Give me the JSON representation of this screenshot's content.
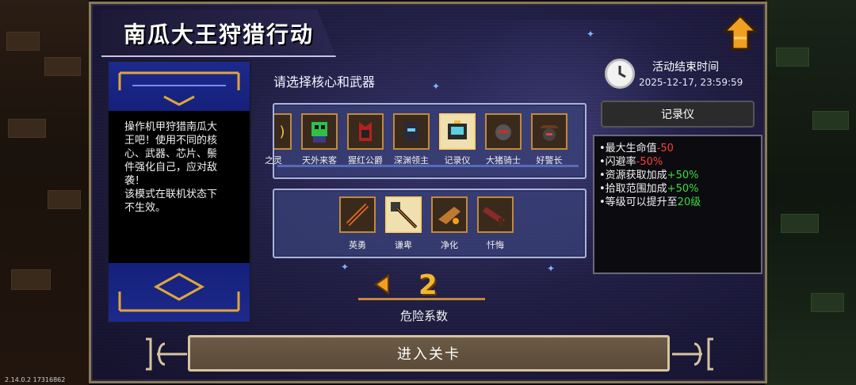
{
  "title": "南瓜大王狩猎行动",
  "description": [
    "操作机甲狩猎南瓜大",
    "王吧！使用不同的核",
    "心、武器、芯片、鬃",
    "件强化自己，应对敌",
    "袭！",
    "该模式在联机状态下",
    "不生效。"
  ],
  "core_weapon_prompt": "请选择核心和武器",
  "cores": [
    {
      "label": "之灵",
      "icon": "spirit-core-icon"
    },
    {
      "label": "天外来客",
      "icon": "alien-visitor-core-icon"
    },
    {
      "label": "猩红公爵",
      "icon": "scarlet-duke-core-icon"
    },
    {
      "label": "深渊领主",
      "icon": "abyss-lord-core-icon"
    },
    {
      "label": "记录仪",
      "icon": "recorder-core-icon",
      "selected": true
    },
    {
      "label": "大猪骑士",
      "icon": "pig-knight-core-icon"
    },
    {
      "label": "好警长",
      "icon": "sheriff-core-icon"
    }
  ],
  "weapons": [
    {
      "label": "英勇",
      "icon": "brave-weapon-icon"
    },
    {
      "label": "谦卑",
      "icon": "humble-weapon-icon",
      "selected": true
    },
    {
      "label": "净化",
      "icon": "purify-weapon-icon"
    },
    {
      "label": "忏悔",
      "icon": "repent-weapon-icon"
    }
  ],
  "difficulty": {
    "value": "2",
    "label": "危险系数"
  },
  "event_end": {
    "label": "活动结束时间",
    "value": "2025-12-17, 23:59:59"
  },
  "selected_core": {
    "name": "记录仪",
    "stats": [
      {
        "text": "•最大生命值",
        "value": "-50",
        "tone": "neg"
      },
      {
        "text": "•闪避率",
        "value": "-50%",
        "tone": "neg"
      },
      {
        "text": "•资源获取加成",
        "value": "+50%",
        "tone": "pos"
      },
      {
        "text": "•拾取范围加成",
        "value": "+50%",
        "tone": "pos"
      },
      {
        "text": "•等级可以提升至",
        "value": "20级",
        "tone": "pos"
      }
    ]
  },
  "enter_button": "进入关卡",
  "version": "2.14.0.2 17316862",
  "colors": {
    "accent_gold": "#f0b830",
    "negative": "#ff3d3d",
    "positive": "#3ddc3d",
    "frame": "#8a7a52"
  }
}
